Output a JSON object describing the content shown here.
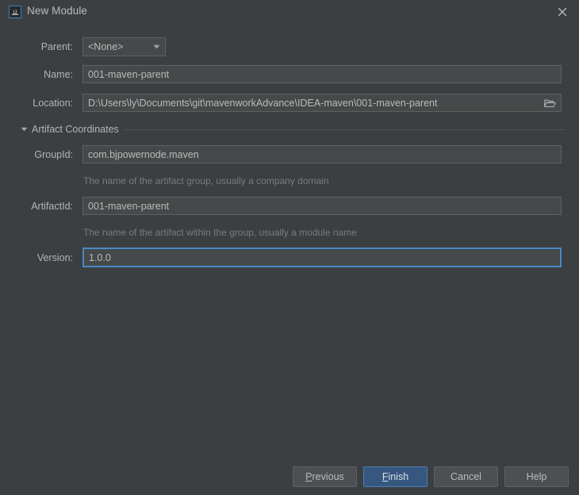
{
  "window": {
    "title": "New Module",
    "app_icon": "intellij-idea-icon",
    "close_label": "✕"
  },
  "form": {
    "parent": {
      "label": "Parent:",
      "value": "<None>",
      "options": [
        "<None>"
      ]
    },
    "name": {
      "label": "Name:",
      "value": "001-maven-parent"
    },
    "location": {
      "label": "Location:",
      "value": "D:\\Users\\ly\\Documents\\git\\mavenworkAdvance\\IDEA-maven\\001-maven-parent",
      "browse_icon": "folder-icon"
    }
  },
  "artifact_coordinates": {
    "section_title": "Artifact Coordinates",
    "expanded": true,
    "group_id": {
      "label": "GroupId:",
      "value": "com.bjpowernode.maven",
      "hint": "The name of the artifact group, usually a company domain"
    },
    "artifact_id": {
      "label": "ArtifactId:",
      "value": "001-maven-parent",
      "hint": "The name of the artifact within the group, usually a module name"
    },
    "version": {
      "label": "Version:",
      "value": "1.0.0",
      "focused": true
    }
  },
  "buttons": {
    "previous": {
      "label": "Previous",
      "mnemonic": "P",
      "rest": "revious"
    },
    "finish": {
      "label": "Finish",
      "mnemonic": "F",
      "rest": "inish",
      "primary": true
    },
    "cancel": {
      "label": "Cancel"
    },
    "help": {
      "label": "Help"
    }
  },
  "colors": {
    "dialog_background": "#3c3f41",
    "field_background": "#45494a",
    "field_border": "#5e6060",
    "focus_border": "#4a88c7",
    "primary_button": "#365880",
    "text": "#bbbbbb",
    "hint_text": "#777c7e",
    "accent": "#3d7dca"
  }
}
